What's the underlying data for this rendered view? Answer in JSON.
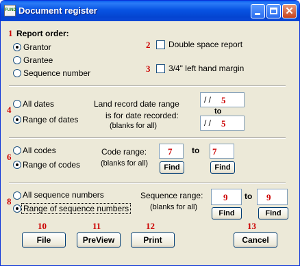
{
  "window": {
    "title": "Document register",
    "icon_text": "FUND"
  },
  "markers": [
    "1",
    "2",
    "3",
    "4",
    "5",
    "6",
    "7",
    "8",
    "9",
    "10",
    "11",
    "12",
    "13"
  ],
  "report_order": {
    "label": "Report order:",
    "options": [
      "Grantor",
      "Grantee",
      "Sequence number"
    ],
    "selected": "Grantor"
  },
  "options": {
    "double_space": "Double space report",
    "left_margin": "3/4\" left hand margin"
  },
  "dates": {
    "all_label": "All dates",
    "range_label": "Range of dates",
    "selected": "Range of dates",
    "range_text_1": "Land record date range",
    "range_text_2": "is for date recorded:",
    "range_text_3": "(blanks for all)",
    "to": "to",
    "from_value": "/ /",
    "to_value": "/ /"
  },
  "codes": {
    "all_label": "All codes",
    "range_label": "Range of codes",
    "selected": "Range of codes",
    "range_label_text": "Code range:",
    "blanks": "(blanks for all)",
    "to": "to",
    "find": "Find"
  },
  "sequence": {
    "all_label": "All sequence numbers",
    "range_label": "Range of sequence numbers",
    "selected": "Range of sequence numbers",
    "range_label_text": "Sequence range:",
    "blanks": "(blanks for all)",
    "to": "to",
    "find": "Find"
  },
  "buttons": {
    "file": "File",
    "preview": "PreView",
    "print": "Print",
    "cancel": "Cancel"
  },
  "colors": {
    "title_bar": "#0854e3",
    "marker": "#cc0000",
    "dialog_bg": "#ece9d8"
  }
}
